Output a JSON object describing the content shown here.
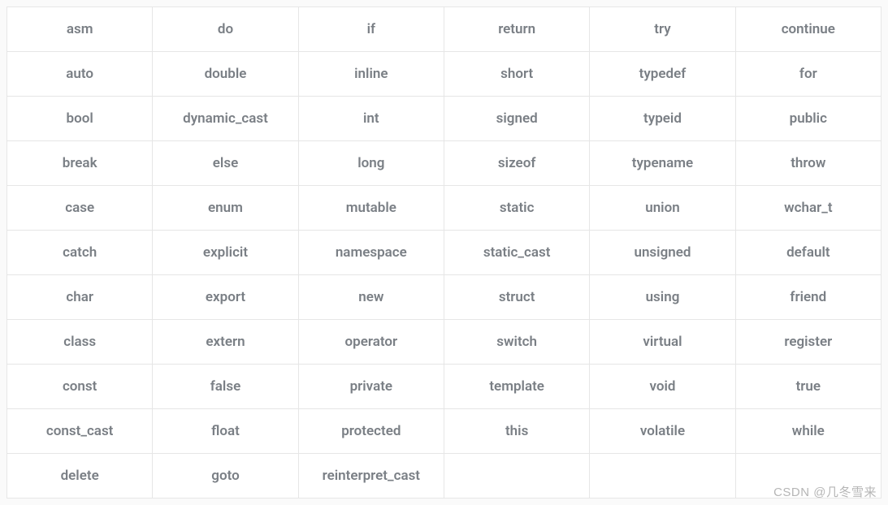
{
  "table": {
    "rows": [
      [
        "asm",
        "do",
        "if",
        "return",
        "try",
        "continue"
      ],
      [
        "auto",
        "double",
        "inline",
        "short",
        "typedef",
        "for"
      ],
      [
        "bool",
        "dynamic_cast",
        "int",
        "signed",
        "typeid",
        "public"
      ],
      [
        "break",
        "else",
        "long",
        "sizeof",
        "typename",
        "throw"
      ],
      [
        "case",
        "enum",
        "mutable",
        "static",
        "union",
        "wchar_t"
      ],
      [
        "catch",
        "explicit",
        "namespace",
        "static_cast",
        "unsigned",
        "default"
      ],
      [
        "char",
        "export",
        "new",
        "struct",
        "using",
        "friend"
      ],
      [
        "class",
        "extern",
        "operator",
        "switch",
        "virtual",
        "register"
      ],
      [
        "const",
        "false",
        "private",
        "template",
        "void",
        "true"
      ],
      [
        "const_cast",
        "float",
        "protected",
        "this",
        "volatile",
        "while"
      ],
      [
        "delete",
        "goto",
        "reinterpret_cast",
        "",
        "",
        ""
      ]
    ]
  },
  "watermark": "CSDN @几冬雪来"
}
